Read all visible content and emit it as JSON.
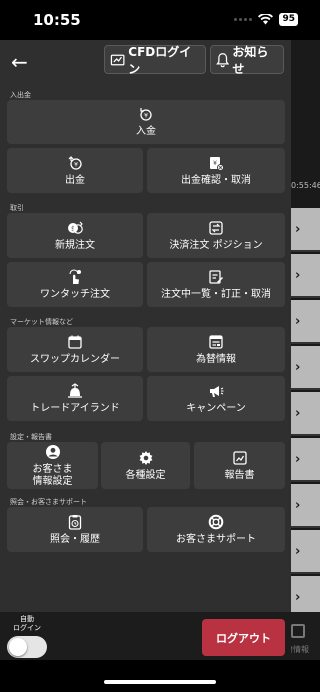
{
  "status_bar": {
    "time": "10:55",
    "battery": "95"
  },
  "header": {
    "cfd_login": "CFDログイン",
    "news": "お知らせ"
  },
  "sections": {
    "deposit": "入出金",
    "trade": "取引",
    "market": "マーケット情報など",
    "settings": "設定・報告書",
    "support": "照会・お客さまサポート"
  },
  "buttons": {
    "deposit": "入金",
    "withdraw": "出金",
    "withdraw_confirm": "出金確認・取消",
    "new_order": "新規注文",
    "settle_order": "決済注文 ポジション",
    "one_touch": "ワンタッチ注文",
    "order_list": "注文中一覧・訂正・取消",
    "swap_calendar": "スワップカレンダー",
    "fx_info": "為替情報",
    "trade_island": "トレードアイランド",
    "campaign": "キャンペーン",
    "customer_info": "お客さま\n情報設定",
    "settings": "各種設定",
    "report": "報告書",
    "inquiry": "照会・履歴",
    "support": "お客さまサポート"
  },
  "footer": {
    "auto_login": "自動\nログイン",
    "auto_login_on": false,
    "logout": "ログアウト"
  },
  "background": {
    "time": "0:55:46",
    "footer_label": "替情報"
  }
}
